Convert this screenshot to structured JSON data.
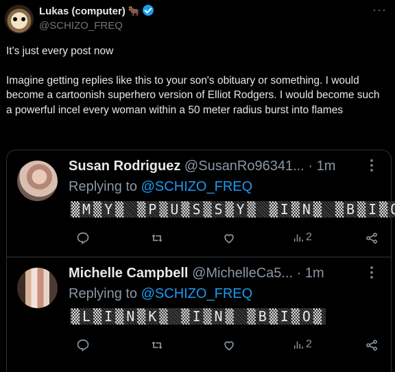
{
  "post": {
    "author_name": "Lukas (computer)",
    "author_handle": "@SCHIZO_FREQ",
    "emoji_icon": "bull-emoji",
    "verified_icon": "verified-badge-icon",
    "paragraph_1": "It's just every post now",
    "paragraph_2": "Imagine getting replies like this to your son's obituary or something. I would become a cartoonish superhero version of Elliot Rodgers. I would become such a powerful incel every woman within a 50 meter radius burst into flames"
  },
  "replies": [
    {
      "name": "Susan Rodriguez",
      "handle": "@SusanRo96341...",
      "time": "· 1m",
      "replying_prefix": "Replying to ",
      "replying_handle": "@SCHIZO_FREQ",
      "text": "MY PUSSY IN BIO",
      "display_text": "▒M▒Y▒ ▒P▒U▒S▒S▒Y▒ ▒I▒N▒ ▒B▒I▒O▒",
      "views": "2"
    },
    {
      "name": "Michelle Campbell",
      "handle": "@MichelleCa5...",
      "time": "· 1m",
      "replying_prefix": "Replying to ",
      "replying_handle": "@SCHIZO_FREQ",
      "text": "LINK IN BIO",
      "display_text": "▒L▒I▒N▒K▒ ▒I▒N▒ ▒B▒I▒O▒",
      "views": "2"
    }
  ],
  "colors": {
    "background": "#000000",
    "text": "#e7e9ea",
    "muted": "#8b98a5",
    "accent": "#1d9bf0",
    "border": "#2f3336"
  }
}
